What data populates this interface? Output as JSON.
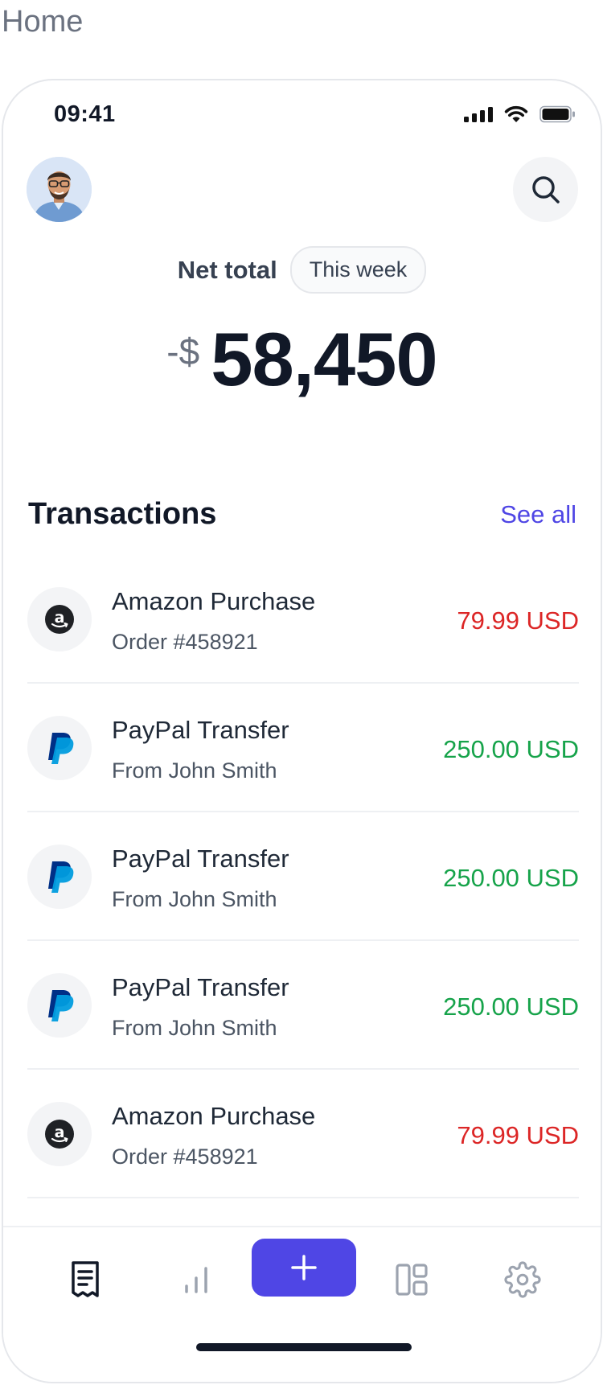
{
  "page": {
    "label": "Home"
  },
  "status_bar": {
    "time": "09:41"
  },
  "header": {
    "avatar_icon": "user-avatar",
    "search_icon": "search-icon"
  },
  "summary": {
    "label": "Net total",
    "period": "This week",
    "prefix": "-$",
    "amount": "58,450"
  },
  "transactions": {
    "title": "Transactions",
    "see_all": "See all",
    "items": [
      {
        "icon": "amazon-icon",
        "title": "Amazon Purchase",
        "subtitle": "Order #458921",
        "amount": "79.99 USD",
        "type": "debit"
      },
      {
        "icon": "paypal-icon",
        "title": "PayPal Transfer",
        "subtitle": "From John Smith",
        "amount": "250.00 USD",
        "type": "credit"
      },
      {
        "icon": "paypal-icon",
        "title": "PayPal Transfer",
        "subtitle": "From John Smith",
        "amount": "250.00 USD",
        "type": "credit"
      },
      {
        "icon": "paypal-icon",
        "title": "PayPal Transfer",
        "subtitle": "From John Smith",
        "amount": "250.00 USD",
        "type": "credit"
      },
      {
        "icon": "amazon-icon",
        "title": "Amazon Purchase",
        "subtitle": "Order #458921",
        "amount": "79.99 USD",
        "type": "debit"
      }
    ]
  },
  "bottom_nav": {
    "items": [
      "receipt-icon",
      "bar-chart-icon",
      "plus-icon",
      "layout-grid-icon",
      "gear-icon"
    ],
    "active": "receipt-icon"
  },
  "colors": {
    "accent": "#4f46e5",
    "debit": "#dc2626",
    "credit": "#16a34a",
    "paypal_dark": "#003087",
    "paypal_light": "#009cde"
  }
}
